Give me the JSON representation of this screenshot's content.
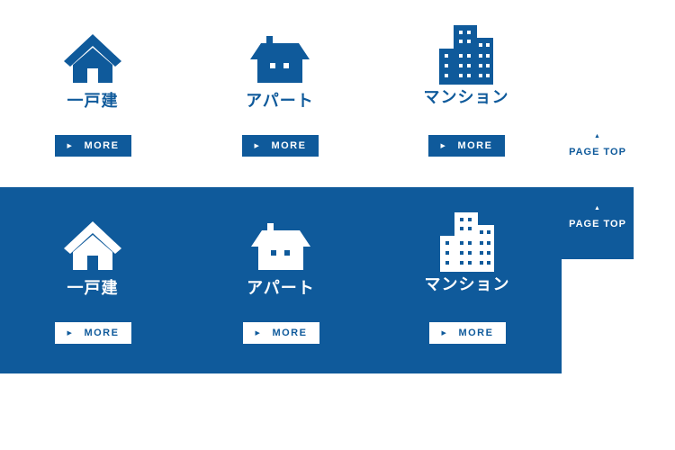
{
  "categories": [
    {
      "label": "一戸建",
      "icon": "house-icon"
    },
    {
      "label": "アパート",
      "icon": "apartment-icon"
    },
    {
      "label": "マンション",
      "icon": "mansion-building-icon"
    }
  ],
  "more_label": "MORE",
  "page_top_label": "PAGE TOP",
  "colors": {
    "brand_blue": "#0f5a9b",
    "white": "#ffffff"
  }
}
